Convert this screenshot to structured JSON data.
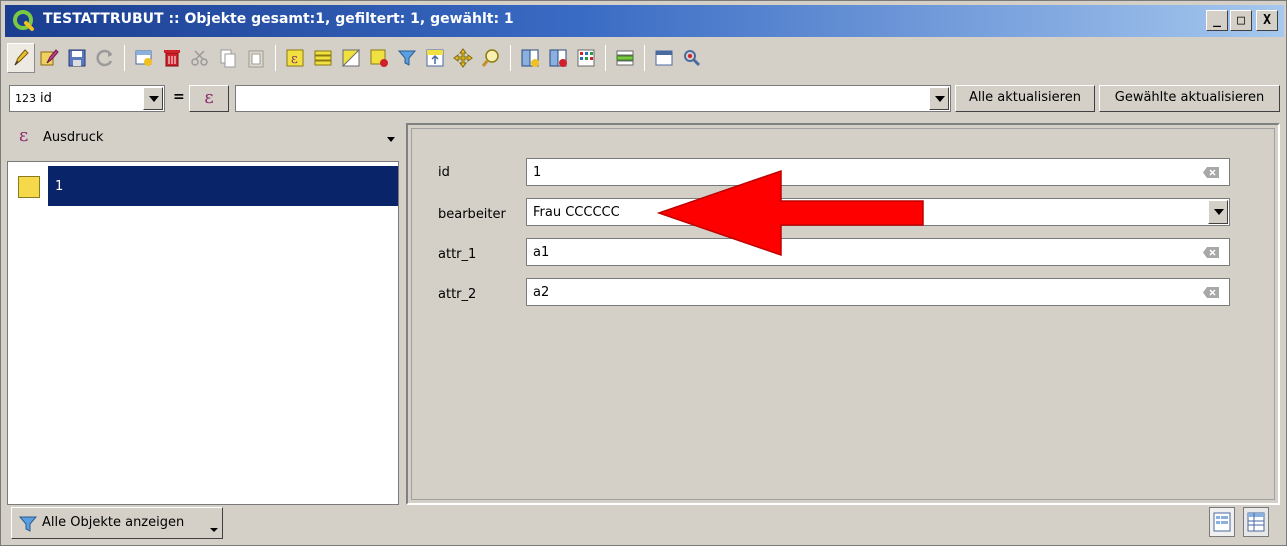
{
  "window": {
    "title": "TESTATTRUBUT :: Objekte gesamt:1, gefiltert: 1, gewählt: 1",
    "minimize": "_",
    "maximize": "□",
    "close": "X"
  },
  "toolbar": {
    "icons": [
      "edit-pencil-icon",
      "multi-edit-icon",
      "save-icon",
      "reload-icon",
      "add-feature-icon",
      "delete-icon",
      "cut-icon",
      "copy-icon",
      "paste-icon",
      "expression-select-icon",
      "select-all-icon",
      "invert-selection-icon",
      "deselect-icon",
      "filter-icon",
      "move-top-icon",
      "pan-icon",
      "zoom-icon",
      "new-field-icon",
      "delete-field-icon",
      "field-calc-icon",
      "conditional-format-icon",
      "dock-icon",
      "actions-icon"
    ]
  },
  "field_calc": {
    "type_label": "123",
    "field": "id",
    "equals": "=",
    "expression_symbol": "ε",
    "expression_value": "",
    "update_all_label": "Alle aktualisieren",
    "update_selected_label": "Gewählte aktualisieren"
  },
  "left_panel": {
    "header_symbol": "ε",
    "header_label": "Ausdruck",
    "items": [
      {
        "label": "1",
        "selected": true
      }
    ]
  },
  "form": {
    "fields": [
      {
        "label": "id",
        "value": "1",
        "kind": "text"
      },
      {
        "label": "bearbeiter",
        "value": "Frau CCCCCC",
        "kind": "combo"
      },
      {
        "label": "attr_1",
        "value": "a1",
        "kind": "text"
      },
      {
        "label": "attr_2",
        "value": "a2",
        "kind": "text"
      }
    ]
  },
  "bottom": {
    "show_all_label": "Alle Objekte anzeigen"
  },
  "colors": {
    "selection": "#0a246a",
    "swatch": "#f5d94a",
    "arrow": "#ff0000",
    "title_start": "#1a3d8f"
  }
}
